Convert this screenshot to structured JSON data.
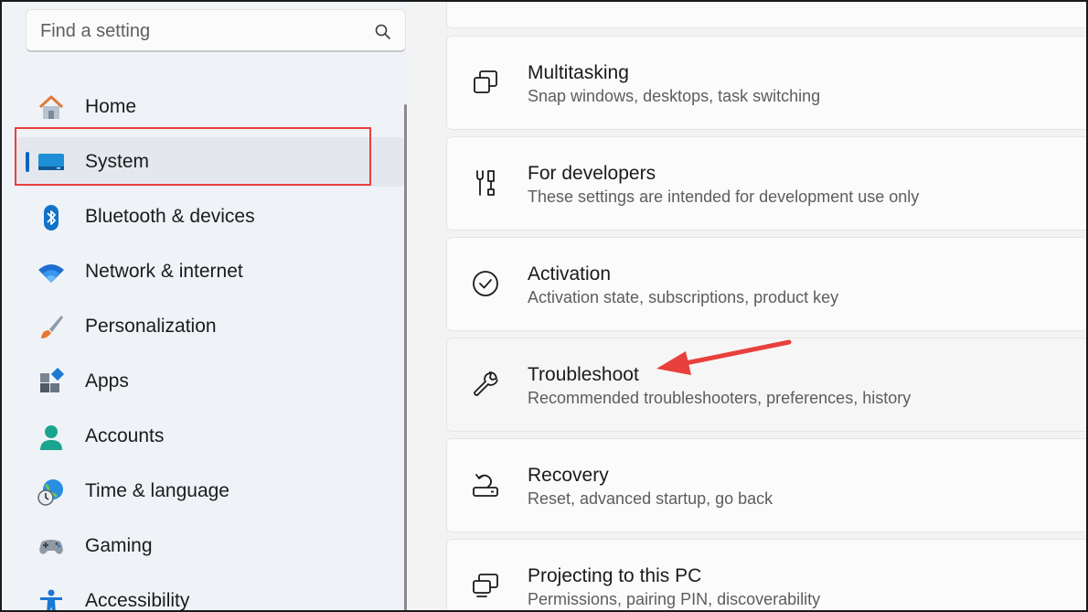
{
  "search": {
    "placeholder": "Find a setting"
  },
  "sidebar": {
    "items": [
      {
        "label": "Home",
        "icon": "home-icon"
      },
      {
        "label": "System",
        "icon": "system-icon",
        "selected": true
      },
      {
        "label": "Bluetooth & devices",
        "icon": "bluetooth-icon"
      },
      {
        "label": "Network & internet",
        "icon": "wifi-icon"
      },
      {
        "label": "Personalization",
        "icon": "brush-icon"
      },
      {
        "label": "Apps",
        "icon": "apps-icon"
      },
      {
        "label": "Accounts",
        "icon": "accounts-icon"
      },
      {
        "label": "Time & language",
        "icon": "globe-clock-icon"
      },
      {
        "label": "Gaming",
        "icon": "gamepad-icon"
      },
      {
        "label": "Accessibility",
        "icon": "accessibility-icon"
      }
    ]
  },
  "main": {
    "cards": [
      {
        "title": "Multitasking",
        "desc": "Snap windows, desktops, task switching",
        "icon": "multitasking-icon"
      },
      {
        "title": "For developers",
        "desc": "These settings are intended for development use only",
        "icon": "developer-tools-icon"
      },
      {
        "title": "Activation",
        "desc": "Activation state, subscriptions, product key",
        "icon": "check-circle-icon"
      },
      {
        "title": "Troubleshoot",
        "desc": "Recommended troubleshooters, preferences, history",
        "icon": "wrench-icon"
      },
      {
        "title": "Recovery",
        "desc": "Reset, advanced startup, go back",
        "icon": "recovery-icon"
      },
      {
        "title": "Projecting to this PC",
        "desc": "Permissions, pairing PIN, discoverability",
        "icon": "projecting-icon"
      }
    ]
  },
  "colors": {
    "accent": "#0067c0",
    "annotation": "#e8403c"
  }
}
